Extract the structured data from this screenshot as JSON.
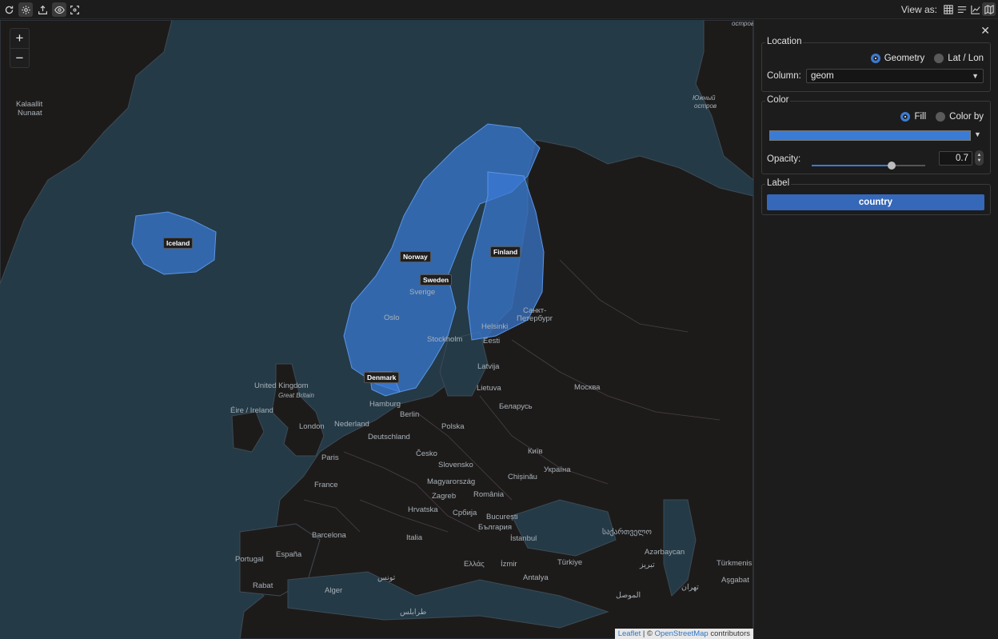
{
  "toolbar": {
    "icons": [
      "refresh-icon",
      "settings-icon",
      "export-icon",
      "eye-icon",
      "focus-icon"
    ],
    "view_as_label": "View as:",
    "view_icons": [
      "table-icon",
      "list-icon",
      "chart-icon",
      "map-icon"
    ]
  },
  "map": {
    "zoom_in": "+",
    "zoom_out": "−",
    "places": {
      "kalaallit": "Kalaallit",
      "nunaat": "Nunaat",
      "uk": "United Kingdom",
      "gb": "Great Britain",
      "ireland": "Éire / Ireland",
      "london": "London",
      "nederland": "Nederland",
      "hamburg": "Hamburg",
      "berlin": "Berlin",
      "deutschland": "Deutschland",
      "polska": "Polska",
      "paris": "Paris",
      "france": "France",
      "cesko": "Česko",
      "slovensko": "Slovensko",
      "magyarorszag": "Magyarország",
      "zagreb": "Zagreb",
      "hrvatska": "Hrvatska",
      "srbija": "Србија",
      "romania": "România",
      "bucuresti": "București",
      "bulgaria": "България",
      "chisinau": "Chișinău",
      "kyiv": "Київ",
      "ukraina": "Україна",
      "belarus": "Беларусь",
      "moskva": "Москва",
      "latvija": "Latvija",
      "lietuva": "Lietuva",
      "eesti": "Eesti",
      "helsinki": "Helsinki",
      "stockholm": "Stockholm",
      "sverige": "Sverige",
      "oslo": "Oslo",
      "spb1": "Санкт-",
      "spb2": "Петербург",
      "barcelona": "Barcelona",
      "espana": "España",
      "portugal": "Portugal",
      "italia": "Italia",
      "istanbul": "İstanbul",
      "turkiye": "Türkiye",
      "ellas": "Ελλάς",
      "izmir": "İzmir",
      "antalya": "Antalya",
      "azerbaycan": "Azərbaycan",
      "turkmenis": "Türkmenis",
      "asgabat": "Aşgabat",
      "rabat": "Rabat",
      "alger": "Alger",
      "tunis": "تونس",
      "trablus": "طرابلس",
      "mosul": "الموصل",
      "georgia": "საქართველო",
      "tabriz": "تبریز",
      "tehran": "تهران",
      "ostrov": "острова",
      "yuzhny": "Южный",
      "ostrov2": "остров"
    },
    "labels": {
      "iceland": "Iceland",
      "norway": "Norway",
      "sweden": "Sweden",
      "finland": "Finland",
      "denmark": "Denmark"
    },
    "attribution": {
      "leaflet": "Leaflet",
      "sep": " | © ",
      "osm": "OpenStreetMap",
      "contributors": " contributors"
    },
    "fill_color": "#3a7bd5"
  },
  "panel": {
    "close": "✕",
    "location": {
      "legend": "Location",
      "geometry": "Geometry",
      "latlon": "Lat / Lon",
      "selected": "Geometry",
      "column_label": "Column:",
      "column_value": "geom"
    },
    "color": {
      "legend": "Color",
      "fill": "Fill",
      "color_by": "Color by",
      "selected": "Fill",
      "swatch": "#3a7bd5",
      "opacity_label": "Opacity:",
      "opacity_value": "0.7",
      "opacity": 0.7
    },
    "label": {
      "legend": "Label",
      "value": "country"
    }
  }
}
